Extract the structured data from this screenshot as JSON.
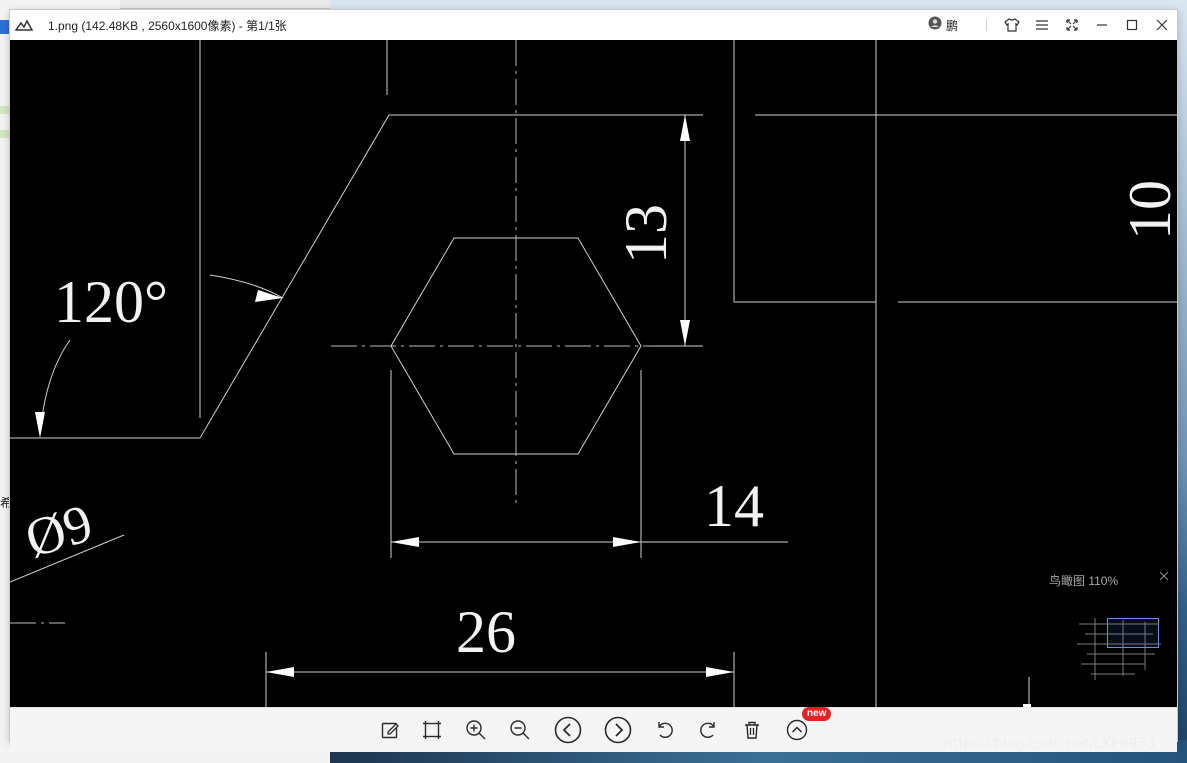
{
  "window": {
    "title": "1.png (142.48KB , 2560x1600像素) - 第1/1张",
    "user_name": "鹏"
  },
  "drawing": {
    "angle_label": "120°",
    "diameter_label": "Ø9",
    "dim_13": "13",
    "dim_14": "14",
    "dim_26": "26",
    "dim_10": "10"
  },
  "birds_eye": {
    "label": "鸟瞰图 110%"
  },
  "toolbar": {
    "new_badge": "new"
  },
  "watermark": {
    "text": "https://blog.csdn.net/LXP8933"
  },
  "background": {
    "side_text": "希"
  }
}
